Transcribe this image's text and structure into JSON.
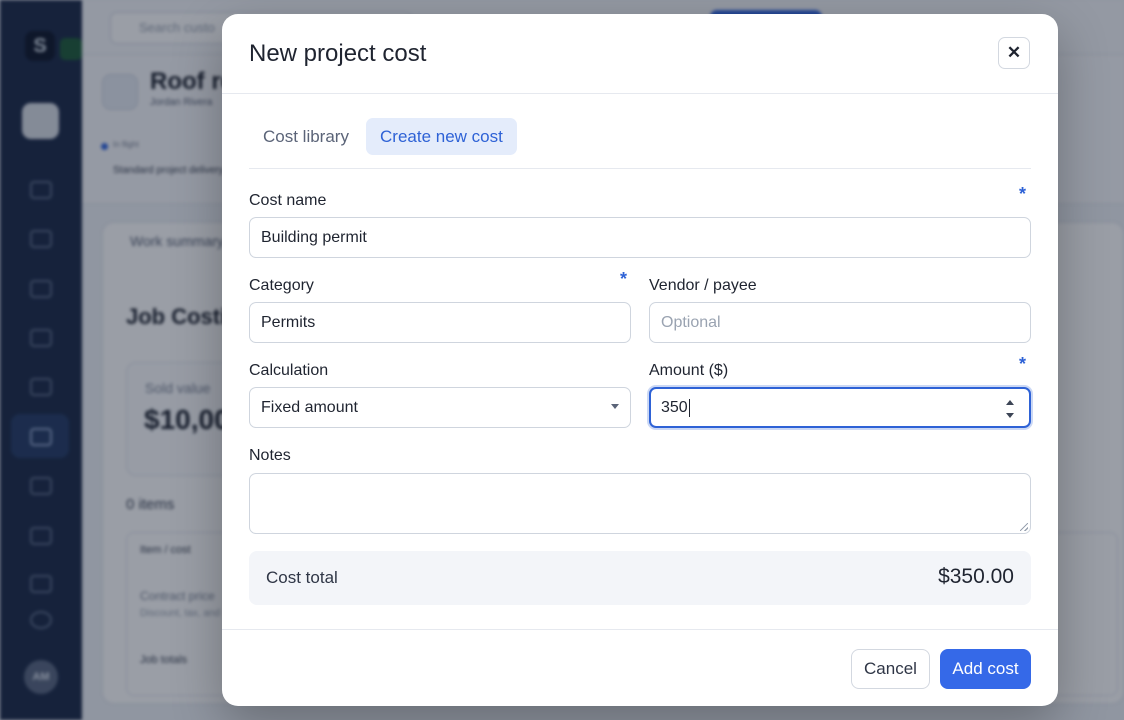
{
  "background": {
    "search_placeholder": "Search custo",
    "project_title": "Roof re",
    "project_owner": "Jordan Rivera",
    "status_small": "In flight",
    "status_line": "Standard project delivery",
    "tab_work_summary": "Work summary",
    "section_title": "Job Costi",
    "stat_label": "Sold value",
    "stat_value": "$10,00",
    "items_count": "0 items",
    "table_header": "Item / cost",
    "row_contract": "Contract price",
    "row_discount": "Discount, tax, and",
    "row_job_totals": "Job totals",
    "avatar_initials": "AM",
    "logo_glyph": "S"
  },
  "modal": {
    "title": "New project cost",
    "close_icon": "close-icon",
    "tabs": [
      {
        "label": "Cost library",
        "active": false
      },
      {
        "label": "Create new cost",
        "active": true
      }
    ],
    "fields": {
      "cost_name": {
        "label": "Cost name",
        "value": "Building permit",
        "required": true
      },
      "category": {
        "label": "Category",
        "value": "Permits",
        "required": true
      },
      "vendor": {
        "label": "Vendor / payee",
        "value": "",
        "placeholder": "Optional",
        "required": false
      },
      "calculation": {
        "label": "Calculation",
        "value": "Fixed amount",
        "required": false
      },
      "amount": {
        "label": "Amount ($)",
        "value": "350",
        "required": true
      },
      "notes": {
        "label": "Notes",
        "value": ""
      }
    },
    "required_marker": "*",
    "total": {
      "label": "Cost total",
      "value": "$350.00"
    },
    "buttons": {
      "cancel": "Cancel",
      "add": "Add cost"
    }
  },
  "colors": {
    "accent": "#3569e8",
    "sidebar": "#1c2a48",
    "overlay": "rgba(15,23,42,0.42)"
  }
}
